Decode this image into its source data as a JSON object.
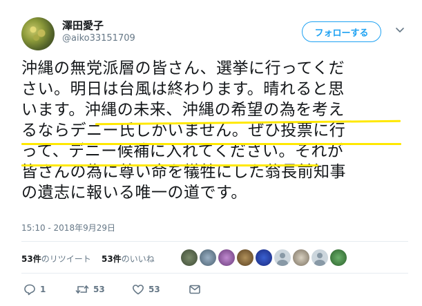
{
  "user": {
    "display_name": "澤田愛子",
    "handle": "@aiko33151709"
  },
  "follow_button": {
    "label": "フォローする"
  },
  "tweet": {
    "lines": [
      "沖縄の無党派層の皆さん、選挙に行ってくだ",
      "さい。明日は台風は終わります。晴れると思",
      "います。沖縄の未来、沖縄の希望の為を考え",
      "るならデニー氏しかいません。ぜひ投票に行",
      "って、デニー候補に入れてください。それが",
      "皆さんの為に尊い命を犠牲にした翁長前知事",
      "の遺志に報いる唯一の道です。"
    ],
    "highlight_color": "#ffe800"
  },
  "timestamp": "15:10 - 2018年9月29日",
  "stats": {
    "retweets_count": "53件",
    "retweets_label": "のリツイート",
    "likes_count": "53件",
    "likes_label": "のいいね"
  },
  "actions": {
    "reply_count": "1",
    "retweet_count": "53",
    "like_count": "53"
  },
  "icons": [
    "chevron-down-icon",
    "reply-icon",
    "retweet-icon",
    "like-icon",
    "direct-message-icon"
  ],
  "colors": {
    "accent": "#1da1f2",
    "secondary_text": "#657786",
    "divider": "#e6ecf0"
  }
}
